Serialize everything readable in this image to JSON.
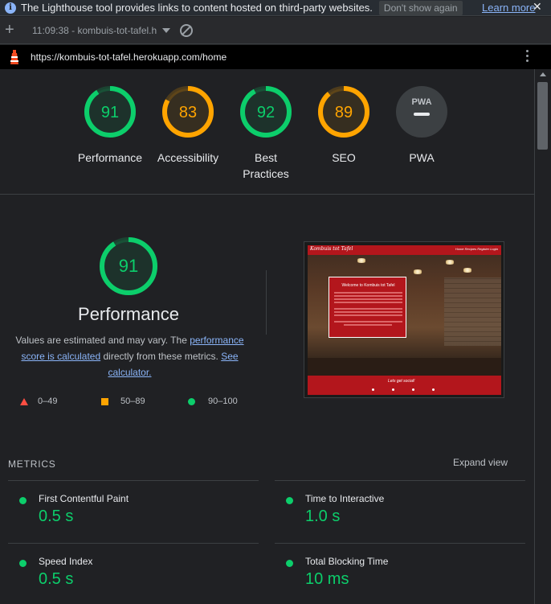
{
  "infobar": {
    "message": "The Lighthouse tool provides links to content hosted on third-party websites.",
    "dont_show": "Don't show again",
    "learn_more": "Learn more",
    "close": "✕"
  },
  "toolbar": {
    "add": "+",
    "report_select": "11:09:38 - kombuis-tot-tafel.h"
  },
  "urlbar": {
    "url": "https://kombuis-tot-tafel.herokuapp.com/home"
  },
  "colors": {
    "pass": "#0cce6b",
    "average": "#ffa400",
    "fail": "#ff4e42",
    "pwa": "#9aa0a6"
  },
  "gauges": [
    {
      "score": 91,
      "label": "Performance",
      "rating": "pass"
    },
    {
      "score": 83,
      "label": "Accessibility",
      "rating": "average"
    },
    {
      "score": 92,
      "label": "Best Practices",
      "rating": "pass"
    },
    {
      "score": 89,
      "label": "SEO",
      "rating": "average"
    },
    {
      "score": null,
      "label": "PWA",
      "badge": "PWA",
      "rating": "pwa"
    }
  ],
  "performance": {
    "score": 91,
    "title": "Performance",
    "desc_prefix": "Values are estimated and may vary. The ",
    "desc_link1": "performance score is calculated",
    "desc_middle": " directly from these metrics. ",
    "desc_link2": "See calculator.",
    "legend": {
      "fail": "0–49",
      "average": "50–89",
      "pass": "90–100"
    }
  },
  "screenshot": {
    "brand": "Kombuis tot Tafel",
    "nav_links": "Home   Recipes   Register   Login",
    "card_title": "Welcome to Kombuis tot Tafel",
    "footer_text": "Lets get social!"
  },
  "metrics": {
    "title": "METRICS",
    "expand": "Expand view",
    "items": [
      {
        "name": "First Contentful Paint",
        "value": "0.5 s"
      },
      {
        "name": "Time to Interactive",
        "value": "1.0 s"
      },
      {
        "name": "Speed Index",
        "value": "0.5 s"
      },
      {
        "name": "Total Blocking Time",
        "value": "10 ms"
      }
    ]
  }
}
